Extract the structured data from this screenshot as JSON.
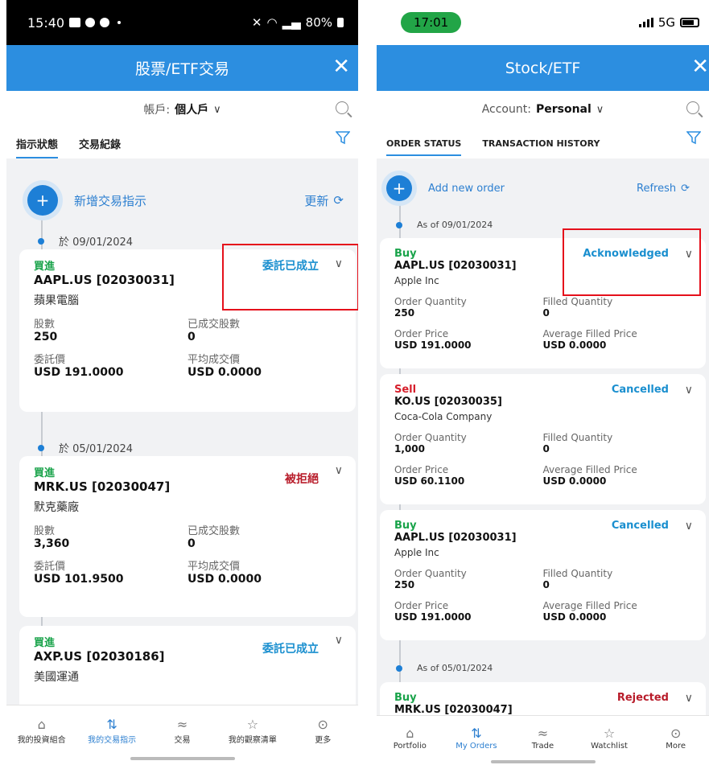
{
  "left": {
    "status": {
      "time": "15:40",
      "battery": "80%"
    },
    "header": {
      "title": "股票/ETF交易",
      "close": "✕"
    },
    "account": {
      "label": "帳戶:",
      "value": "個人戶"
    },
    "tabs": [
      "指示狀態",
      "交易紀錄"
    ],
    "add_label": "新增交易指示",
    "refresh": "更新",
    "dates": [
      "於 09/01/2024",
      "於 05/01/2024"
    ],
    "labels": {
      "qty": "股數",
      "filled": "已成交股數",
      "price": "委託價",
      "avg": "平均成交價"
    },
    "orders": [
      {
        "side": "買進",
        "ticker": "AAPL.US [02030031]",
        "name": "蘋果電腦",
        "status": "委託已成立",
        "qty": "250",
        "filled": "0",
        "price": "USD 191.0000",
        "avg": "USD 0.0000"
      },
      {
        "side": "買進",
        "ticker": "MRK.US [02030047]",
        "name": "默克藥廠",
        "status": "被拒絕",
        "qty": "3,360",
        "filled": "0",
        "price": "USD 101.9500",
        "avg": "USD 0.0000"
      },
      {
        "side": "買進",
        "ticker": "AXP.US [02030186]",
        "name": "美國運通",
        "status": "委託已成立"
      }
    ],
    "nav": [
      "我的投資組合",
      "我的交易指示",
      "交易",
      "我的觀察清單",
      "更多"
    ]
  },
  "right": {
    "status": {
      "time": "17:01",
      "network": "5G"
    },
    "header": {
      "title": "Stock/ETF",
      "close": "✕"
    },
    "account": {
      "label": "Account:",
      "value": "Personal"
    },
    "tabs": [
      "ORDER STATUS",
      "TRANSACTION HISTORY"
    ],
    "add_label": "Add new order",
    "refresh": "Refresh",
    "dates": [
      "As of 09/01/2024",
      "As of 05/01/2024"
    ],
    "labels": {
      "qty": "Order Quantity",
      "filled": "Filled Quantity",
      "price": "Order Price",
      "avg": "Average Filled Price"
    },
    "orders": [
      {
        "side": "Buy",
        "ticker": "AAPL.US [02030031]",
        "name": "Apple Inc",
        "status": "Acknowledged",
        "qty": "250",
        "filled": "0",
        "price": "USD 191.0000",
        "avg": "USD 0.0000"
      },
      {
        "side": "Sell",
        "ticker": "KO.US [02030035]",
        "name": "Coca-Cola Company",
        "status": "Cancelled",
        "qty": "1,000",
        "filled": "0",
        "price": "USD 60.1100",
        "avg": "USD 0.0000"
      },
      {
        "side": "Buy",
        "ticker": "AAPL.US [02030031]",
        "name": "Apple Inc",
        "status": "Cancelled",
        "qty": "250",
        "filled": "0",
        "price": "USD 191.0000",
        "avg": "USD 0.0000"
      },
      {
        "side": "Buy",
        "ticker": "MRK.US [02030047]",
        "status": "Rejected"
      }
    ],
    "nav": [
      "Portfolio",
      "My Orders",
      "Trade",
      "Watchlist",
      "More"
    ]
  }
}
